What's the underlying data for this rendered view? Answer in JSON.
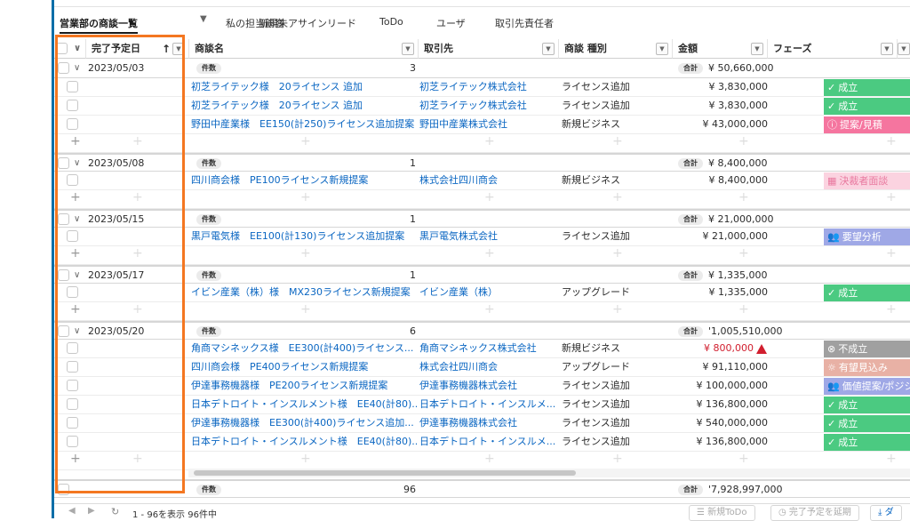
{
  "tabs": [
    {
      "label": "営業部の商談一覧",
      "active": true
    },
    {
      "label": "私の担当顧客"
    },
    {
      "label": "新規未アサインリード"
    },
    {
      "label": "ToDo"
    },
    {
      "label": "ユーザ"
    },
    {
      "label": "取引先責任者"
    }
  ],
  "tab_caret": "▼",
  "columns": {
    "close_date": "完了予定日",
    "name": "商談名",
    "account": "取引先",
    "type": "商談 種別",
    "amount": "金額",
    "phase": "フェーズ",
    "cut": "完"
  },
  "sort_icon": "↑",
  "labels": {
    "count": "件数",
    "sum": "合計"
  },
  "groups": [
    {
      "date": "2023/05/03",
      "count": "3",
      "sum": "¥ 50,660,000",
      "rows": [
        {
          "name": "初芝ライテック様　20ライセンス 追加",
          "account": "初芝ライテック株式会社",
          "type": "ライセンス追加",
          "amount": "¥ 3,830,000",
          "phase": "成立",
          "phase_icon": "check-icon",
          "phase_color": "#4bca81",
          "phase_text_color": "#ffffff"
        },
        {
          "name": "初芝ライテック様　20ライセンス 追加",
          "account": "初芝ライテック株式会社",
          "type": "ライセンス追加",
          "amount": "¥ 3,830,000",
          "phase": "成立",
          "phase_icon": "check-icon",
          "phase_color": "#4bca81",
          "phase_text_color": "#ffffff"
        },
        {
          "name": "野田中産業様　EE150(計250)ライセンス追加提案",
          "account": "野田中産業株式会社",
          "type": "新規ビジネス",
          "amount": "¥ 43,000,000",
          "phase": "提案/見積",
          "phase_icon": "info-icon",
          "phase_color": "#f5759f",
          "phase_text_color": "#ffffff"
        }
      ]
    },
    {
      "date": "2023/05/08",
      "count": "1",
      "sum": "¥ 8,400,000",
      "rows": [
        {
          "name": "四川商会様　PE100ライセンス新規提案",
          "account": "株式会社四川商会",
          "type": "新規ビジネス",
          "amount": "¥ 8,400,000",
          "phase": "決裁者面談",
          "phase_icon": "calendar-icon",
          "phase_color": "#fbd3e0",
          "phase_text_color": "#e8799f"
        }
      ]
    },
    {
      "date": "2023/05/15",
      "count": "1",
      "sum": "¥ 21,000,000",
      "rows": [
        {
          "name": "黒戸電気様　EE100(計130)ライセンス追加提案",
          "account": "黒戸電気株式会社",
          "type": "ライセンス追加",
          "amount": "¥ 21,000,000",
          "phase": "要望分析",
          "phase_icon": "people-icon",
          "phase_color": "#9fa8e6",
          "phase_text_color": "#ffffff"
        }
      ]
    },
    {
      "date": "2023/05/17",
      "count": "1",
      "sum": "¥ 1,335,000",
      "rows": [
        {
          "name": "イビン産業（株）様　MX230ライセンス新規提案",
          "account": "イビン産業（株）",
          "type": "アップグレード",
          "amount": "¥ 1,335,000",
          "phase": "成立",
          "phase_icon": "check-icon",
          "phase_color": "#4bca81",
          "phase_text_color": "#ffffff"
        }
      ]
    },
    {
      "date": "2023/05/20",
      "count": "6",
      "sum": "'1,005,510,000",
      "rows": [
        {
          "name": "角商マシネックス様　EE300(計400)ライセンス...",
          "account": "角商マシネックス株式会社",
          "type": "新規ビジネス",
          "amount": "¥ 800,000",
          "amount_warn": true,
          "phase": "不成立",
          "phase_icon": "x-circle-icon",
          "phase_color": "#a0a0a0",
          "phase_text_color": "#ffffff"
        },
        {
          "name": "四川商会様　PE400ライセンス新規提案",
          "account": "株式会社四川商会",
          "type": "アップグレード",
          "amount": "¥ 91,110,000",
          "phase": "有望見込み",
          "phase_icon": "sun-icon",
          "phase_color": "#e8b1a5",
          "phase_text_color": "#ffffff"
        },
        {
          "name": "伊達事務機器様　PE200ライセンス新規提案",
          "account": "伊達事務機器株式会社",
          "type": "ライセンス追加",
          "amount": "¥ 100,000,000",
          "phase": "価値提案/ポジショニング",
          "phase_icon": "people-icon",
          "phase_color": "#9fa8e6",
          "phase_text_color": "#ffffff"
        },
        {
          "name": "日本デトロイト・インスルメント様　EE40(計80)...",
          "account": "日本デトロイト・インスルメ...",
          "type": "ライセンス追加",
          "amount": "¥ 136,800,000",
          "phase": "成立",
          "phase_icon": "check-icon",
          "phase_color": "#4bca81",
          "phase_text_color": "#ffffff"
        },
        {
          "name": "伊達事務機器様　EE300(計400)ライセンス追加...",
          "account": "伊達事務機器株式会社",
          "type": "ライセンス追加",
          "amount": "¥ 540,000,000",
          "phase": "成立",
          "phase_icon": "check-icon",
          "phase_color": "#4bca81",
          "phase_text_color": "#ffffff"
        },
        {
          "name": "日本デトロイト・インスルメント様　EE40(計80)...",
          "account": "日本デトロイト・インスルメ...",
          "type": "ライセンス追加",
          "amount": "¥ 136,800,000",
          "phase": "成立",
          "phase_icon": "check-icon",
          "phase_color": "#4bca81",
          "phase_text_color": "#ffffff"
        }
      ]
    }
  ],
  "total": {
    "count": "96",
    "sum": "'7,928,997,000"
  },
  "footer": {
    "range": "1 - 96を表示 96件中",
    "new_todo": "新規ToDo",
    "extend": "完了予定を延期",
    "download": "ダ"
  },
  "highlight_color": "#f47721"
}
